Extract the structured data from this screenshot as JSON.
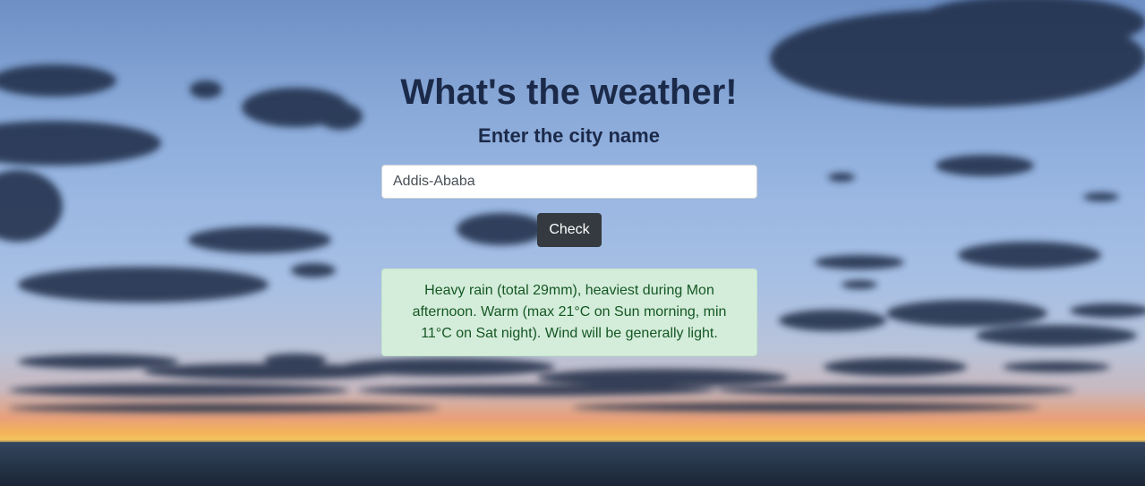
{
  "header": {
    "title": "What's the weather!",
    "subtitle": "Enter the city name"
  },
  "search": {
    "value": "Addis-Ababa",
    "placeholder": ""
  },
  "actions": {
    "check_label": "Check"
  },
  "result": {
    "text": "Heavy rain (total 29mm), heaviest during Mon afternoon. Warm (max 21°C on Sun morning, min 11°C on Sat night). Wind will be generally light."
  },
  "colors": {
    "title": "#1c2a4a",
    "button_bg": "#343a40",
    "alert_bg": "#d4edda",
    "alert_text": "#155724"
  }
}
